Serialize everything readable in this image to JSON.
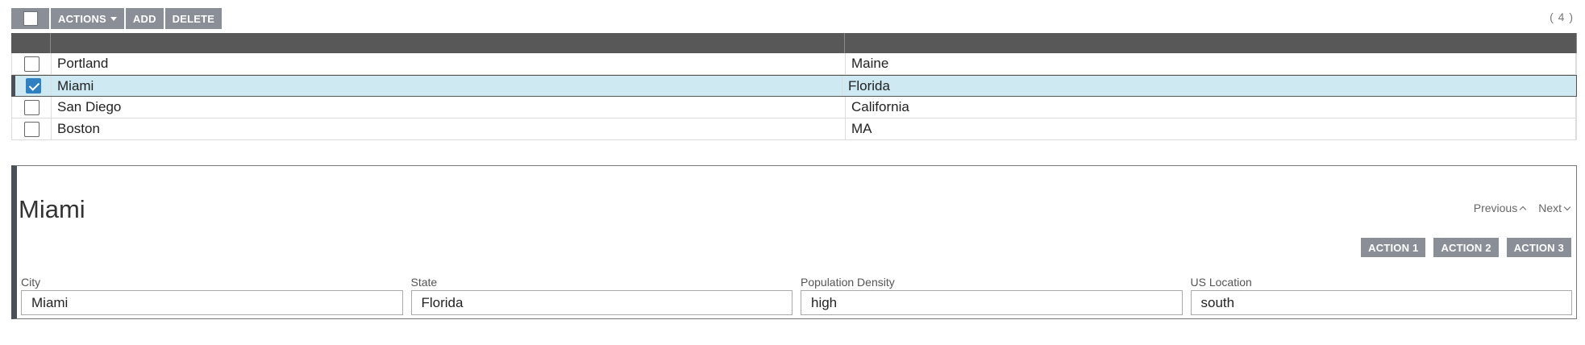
{
  "toolbar": {
    "actions_label": "ACTIONS",
    "add_label": "ADD",
    "delete_label": "DELETE",
    "record_count": "( 4 )"
  },
  "grid": {
    "rows": [
      {
        "city": "Portland",
        "state": "Maine",
        "checked": false
      },
      {
        "city": "Miami",
        "state": "Florida",
        "checked": true
      },
      {
        "city": "San Diego",
        "state": "California",
        "checked": false
      },
      {
        "city": "Boston",
        "state": "MA",
        "checked": false
      }
    ]
  },
  "detail": {
    "title": "Miami",
    "previous_label": "Previous",
    "next_label": "Next",
    "action1_label": "ACTION 1",
    "action2_label": "ACTION 2",
    "action3_label": "ACTION 3",
    "fields": [
      {
        "label": "City",
        "value": "Miami"
      },
      {
        "label": "State",
        "value": "Florida"
      },
      {
        "label": "Population Density",
        "value": "high"
      },
      {
        "label": "US Location",
        "value": "south"
      }
    ]
  },
  "colors": {
    "toolbar_button": "#8a8f97",
    "header_bg": "#585858",
    "selected_row": "#cfe9f3",
    "checkbox_checked": "#2f7fc1"
  }
}
